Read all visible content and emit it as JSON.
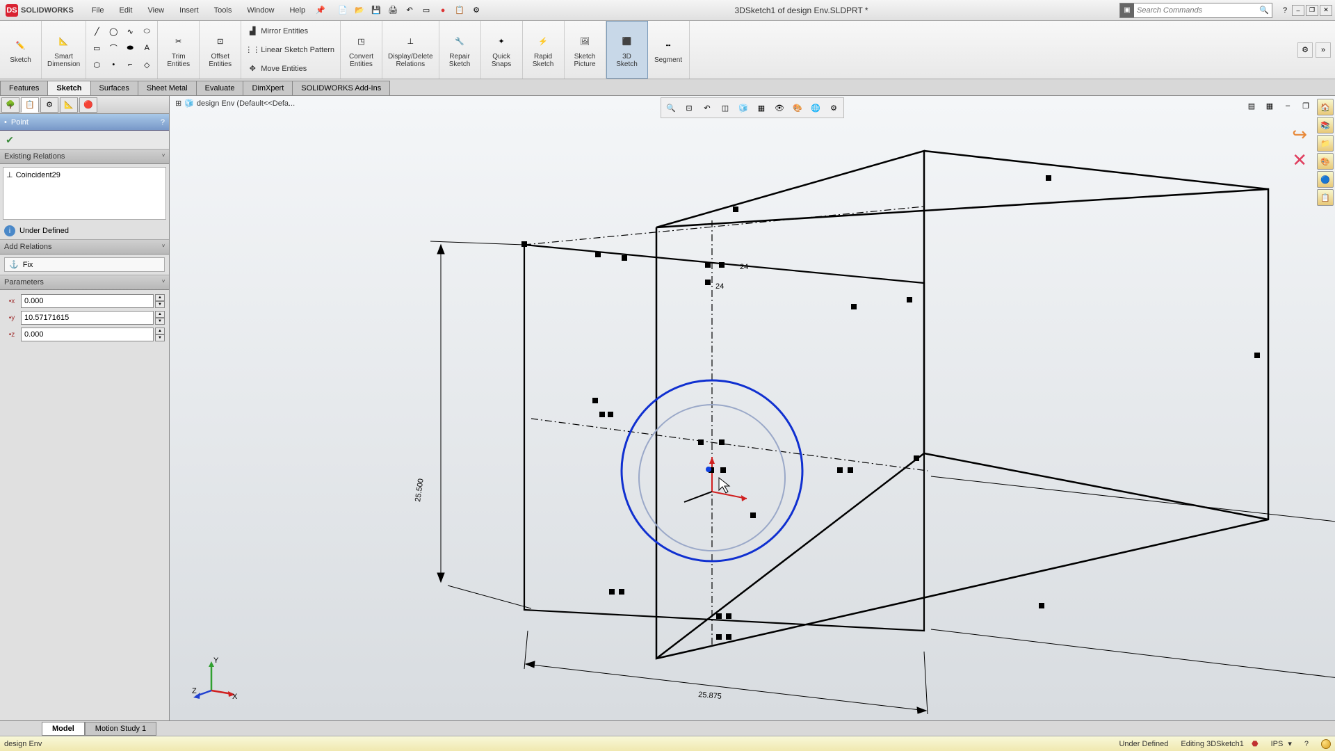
{
  "app": {
    "name": "SOLIDWORKS",
    "title": "3DSketch1 of design Env.SLDPRT *"
  },
  "menu": [
    "File",
    "Edit",
    "View",
    "Insert",
    "Tools",
    "Window",
    "Help"
  ],
  "search": {
    "placeholder": "Search Commands"
  },
  "ribbon": {
    "sketch": "Sketch",
    "smart_dim": "Smart\nDimension",
    "trim": "Trim\nEntities",
    "offset": "Offset\nEntities",
    "convert": "Convert\nEntities",
    "display_del": "Display/Delete\nRelations",
    "repair": "Repair\nSketch",
    "quick_snaps": "Quick\nSnaps",
    "rapid": "Rapid\nSketch",
    "picture": "Sketch\nPicture",
    "sketch3d": "3D\nSketch",
    "segment": "Segment",
    "mirror": "Mirror Entities",
    "linear": "Linear Sketch Pattern",
    "move": "Move Entities"
  },
  "cmtabs": [
    "Features",
    "Sketch",
    "Surfaces",
    "Sheet Metal",
    "Evaluate",
    "DimXpert",
    "SOLIDWORKS Add-Ins"
  ],
  "cmtabs_active": 1,
  "property": {
    "title": "Point",
    "relations_h": "Existing Relations",
    "relation_item": "Coincident29",
    "status": "Under Defined",
    "addrel_h": "Add Relations",
    "fix": "Fix",
    "params_h": "Parameters",
    "x": "0.000",
    "y": "10.57171615",
    "z": "0.000"
  },
  "breadcrumb": "design Env  (Default<<Defa...",
  "dims": {
    "height": "25.500",
    "width": "25.875",
    "top1": "24",
    "top2": "24"
  },
  "triad": {
    "x": "X",
    "y": "Y",
    "z": "Z"
  },
  "bottom_tabs": [
    "Model",
    "Motion Study 1"
  ],
  "bottom_active": 0,
  "statusbar": {
    "left": "design Env",
    "defined": "Under Defined",
    "editing": "Editing 3DSketch1",
    "units": "IPS"
  }
}
